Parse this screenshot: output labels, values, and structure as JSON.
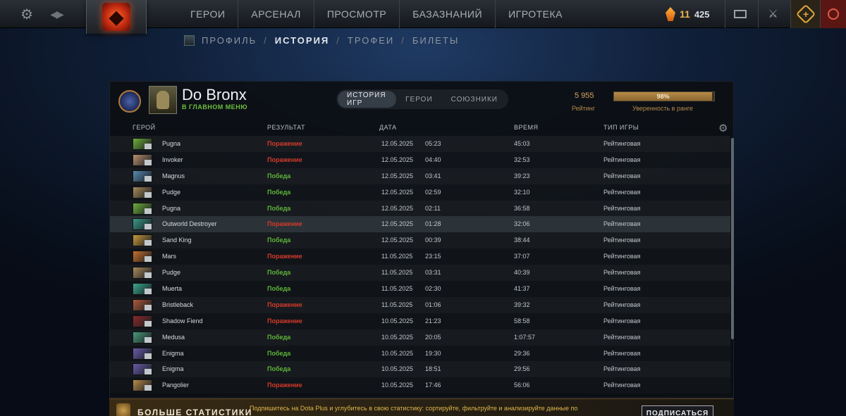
{
  "topbar": {
    "nav": [
      "ГЕРОИ",
      "АРСЕНАЛ",
      "ПРОСМОТР",
      "БАЗАЗНАНИЙ",
      "ИГРОТЕКА"
    ],
    "currency_shards": "11",
    "currency_points": "425"
  },
  "subnav": {
    "profile": "ПРОФИЛЬ",
    "history": "ИСТОРИЯ",
    "trophies": "ТРОФЕИ",
    "tickets": "БИЛЕТЫ",
    "separator": "/"
  },
  "player": {
    "name": "Do Bronx",
    "status": "В ГЛАВНОМ МЕНЮ",
    "rating_value": "5 955",
    "rating_label": "Рейтинг",
    "confidence_value": "98%",
    "confidence_fraction": 0.98,
    "confidence_label": "Уверенность в ранге"
  },
  "tabs": [
    "ИСТОРИЯ ИГР",
    "ГЕРОИ",
    "СОЮЗНИКИ"
  ],
  "columns": {
    "hero": "ГЕРОЙ",
    "result": "РЕЗУЛЬТАТ",
    "date": "ДАТА",
    "duration": "ВРЕМЯ",
    "type": "ТИП ИГРЫ"
  },
  "matches": [
    {
      "hero": "Pugna",
      "result": "Поражение",
      "win": false,
      "date": "12.05.2025",
      "time": "05:23",
      "duration": "45:03",
      "type": "Рейтинговая",
      "color": "#6fae3a"
    },
    {
      "hero": "Invoker",
      "result": "Поражение",
      "win": false,
      "date": "12.05.2025",
      "time": "04:40",
      "duration": "32:53",
      "type": "Рейтинговая",
      "color": "#b89070"
    },
    {
      "hero": "Magnus",
      "result": "Победа",
      "win": true,
      "date": "12.05.2025",
      "time": "03:41",
      "duration": "39:23",
      "type": "Рейтинговая",
      "color": "#5a8ab0"
    },
    {
      "hero": "Pudge",
      "result": "Победа",
      "win": true,
      "date": "12.05.2025",
      "time": "02:59",
      "duration": "32:10",
      "type": "Рейтинговая",
      "color": "#a88a5a"
    },
    {
      "hero": "Pugna",
      "result": "Победа",
      "win": true,
      "date": "12.05.2025",
      "time": "02:11",
      "duration": "36:58",
      "type": "Рейтинговая",
      "color": "#6fae3a"
    },
    {
      "hero": "Outworld Destroyer",
      "result": "Поражение",
      "win": false,
      "date": "12.05.2025",
      "time": "01:28",
      "duration": "32:06",
      "type": "Рейтинговая",
      "color": "#3a9a8a"
    },
    {
      "hero": "Sand King",
      "result": "Победа",
      "win": true,
      "date": "12.05.2025",
      "time": "00:39",
      "duration": "38:44",
      "type": "Рейтинговая",
      "color": "#c89a3a"
    },
    {
      "hero": "Mars",
      "result": "Поражение",
      "win": false,
      "date": "11.05.2025",
      "time": "23:15",
      "duration": "37:07",
      "type": "Рейтинговая",
      "color": "#c8702a"
    },
    {
      "hero": "Pudge",
      "result": "Победа",
      "win": true,
      "date": "11.05.2025",
      "time": "03:31",
      "duration": "40:39",
      "type": "Рейтинговая",
      "color": "#a88a5a"
    },
    {
      "hero": "Muerta",
      "result": "Победа",
      "win": true,
      "date": "11.05.2025",
      "time": "02:30",
      "duration": "41:37",
      "type": "Рейтинговая",
      "color": "#3aa890"
    },
    {
      "hero": "Bristleback",
      "result": "Поражение",
      "win": false,
      "date": "11.05.2025",
      "time": "01:06",
      "duration": "39:32",
      "type": "Рейтинговая",
      "color": "#b05a3a"
    },
    {
      "hero": "Shadow Fiend",
      "result": "Поражение",
      "win": false,
      "date": "10.05.2025",
      "time": "21:23",
      "duration": "58:58",
      "type": "Рейтинговая",
      "color": "#8a2a2a"
    },
    {
      "hero": "Medusa",
      "result": "Победа",
      "win": true,
      "date": "10.05.2025",
      "time": "20:05",
      "duration": "1:07:57",
      "type": "Рейтинговая",
      "color": "#4a9a7a"
    },
    {
      "hero": "Enigma",
      "result": "Победа",
      "win": true,
      "date": "10.05.2025",
      "time": "19:30",
      "duration": "29:36",
      "type": "Рейтинговая",
      "color": "#6a5aa8"
    },
    {
      "hero": "Enigma",
      "result": "Победа",
      "win": true,
      "date": "10.05.2025",
      "time": "18:51",
      "duration": "29:56",
      "type": "Рейтинговая",
      "color": "#6a5aa8"
    },
    {
      "hero": "Pangolier",
      "result": "Поражение",
      "win": false,
      "date": "10.05.2025",
      "time": "17:46",
      "duration": "56:06",
      "type": "Рейтинговая",
      "color": "#b88a4a"
    }
  ],
  "highlighted_row": 5,
  "promo": {
    "title": "БОЛЬШЕ СТАТИСТИКИ",
    "text": "Подпишитесь на Dota Plus и углубитесь в свою статистику: сортируйте, фильтруйте и анализируйте данные по",
    "button": "ПОДПИСАТЬСЯ"
  },
  "colors": {
    "win": "#5fb436",
    "loss": "#d43a2a",
    "accent_gold": "#d8a95c"
  }
}
